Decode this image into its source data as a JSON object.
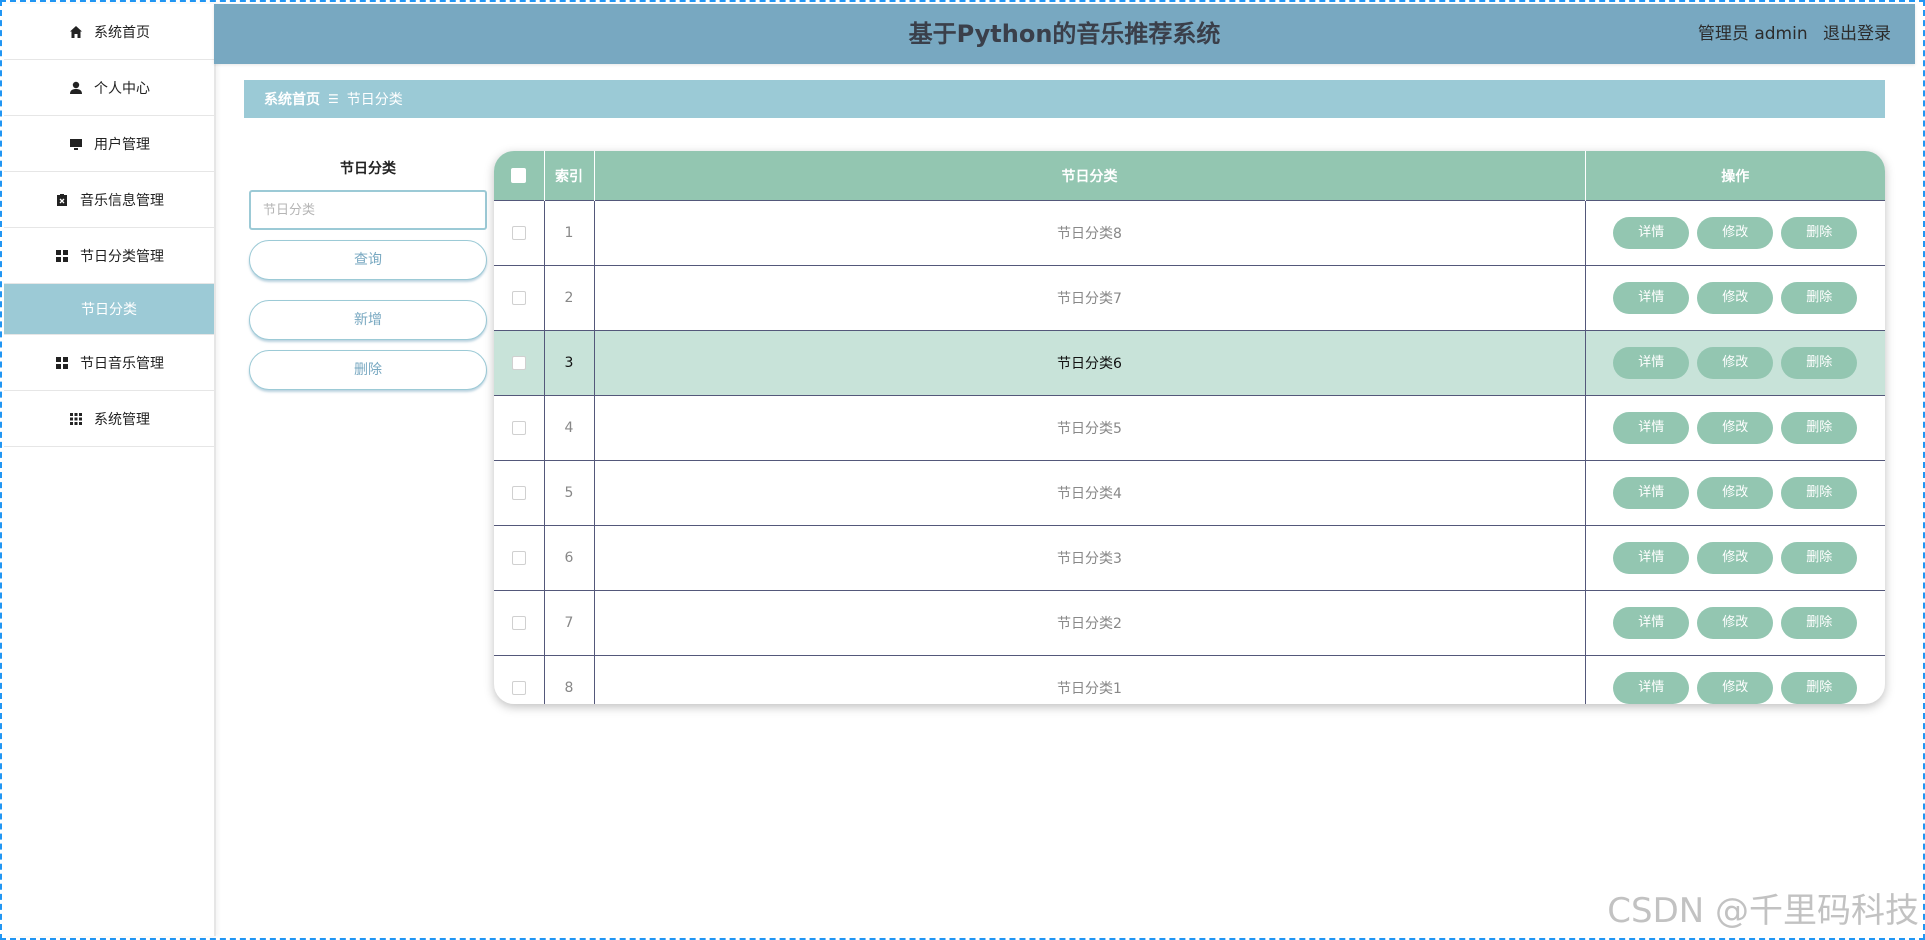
{
  "sidebar": {
    "items": [
      {
        "label": "系统首页",
        "icon": "home-icon"
      },
      {
        "label": "个人中心",
        "icon": "person-icon"
      },
      {
        "label": "用户管理",
        "icon": "monitor-icon"
      },
      {
        "label": "音乐信息管理",
        "icon": "clipboard-icon"
      },
      {
        "label": "节日分类管理",
        "icon": "grid-icon"
      },
      {
        "label": "节日分类",
        "icon": "",
        "active": true
      },
      {
        "label": "节日音乐管理",
        "icon": "grid-icon"
      },
      {
        "label": "系统管理",
        "icon": "apps-icon"
      }
    ]
  },
  "header": {
    "title": "基于Python的音乐推荐系统",
    "user": "管理员 admin",
    "logout": "退出登录"
  },
  "breadcrumb": {
    "home": "系统首页",
    "separator": "☰",
    "current": "节日分类"
  },
  "search": {
    "label": "节日分类",
    "placeholder": "节日分类",
    "query_button": "查询",
    "add_button": "新增",
    "delete_button": "删除"
  },
  "table": {
    "headers": {
      "index": "索引",
      "name": "节日分类",
      "actions": "操作"
    },
    "rows": [
      {
        "index": "1",
        "name": "节日分类8"
      },
      {
        "index": "2",
        "name": "节日分类7"
      },
      {
        "index": "3",
        "name": "节日分类6",
        "highlighted": true
      },
      {
        "index": "4",
        "name": "节日分类5"
      },
      {
        "index": "5",
        "name": "节日分类4"
      },
      {
        "index": "6",
        "name": "节日分类3"
      },
      {
        "index": "7",
        "name": "节日分类2"
      },
      {
        "index": "8",
        "name": "节日分类1"
      }
    ],
    "row_actions": {
      "detail": "详情",
      "edit": "修改",
      "delete": "删除"
    }
  },
  "watermark": "CSDN @千里码科技",
  "colors": {
    "header_bg": "#78a8c1",
    "breadcrumb_bg": "#9bcad6",
    "table_header_bg": "#93c6b1",
    "row_highlight": "#c8e3d9",
    "sidebar_active": "#9ccad6"
  }
}
